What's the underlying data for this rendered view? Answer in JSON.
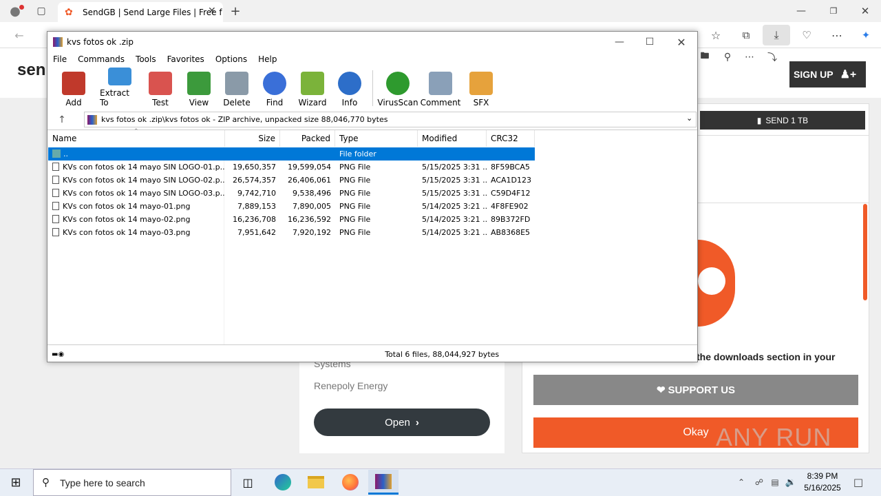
{
  "browser": {
    "tab_title": "SendGB | Send Large Files | Free f",
    "signup_label": "SIGN UP",
    "logo_fragment": "sen"
  },
  "site": {
    "send_button": "SEND 1 TB",
    "downloads_text": "the downloads section in your",
    "support_button": "SUPPORT US",
    "okay_button": "Okay",
    "systems_text": "Systems",
    "renepoly_text": "Renepoly Energy",
    "open_button": "Open",
    "watermark": "ANY RUN"
  },
  "winrar": {
    "title": "kvs fotos ok .zip",
    "menu": [
      "File",
      "Commands",
      "Tools",
      "Favorites",
      "Options",
      "Help"
    ],
    "toolbar": [
      {
        "label": "Add",
        "icon": "add-archive-icon",
        "color": "#c0392b"
      },
      {
        "label": "Extract To",
        "icon": "folder-icon",
        "color": "#3a8fd8"
      },
      {
        "label": "Test",
        "icon": "checklist-icon",
        "color": "#d9534f"
      },
      {
        "label": "View",
        "icon": "book-icon",
        "color": "#3c9a3c"
      },
      {
        "label": "Delete",
        "icon": "trash-icon",
        "color": "#8a9aa8"
      },
      {
        "label": "Find",
        "icon": "magnifier-icon",
        "color": "#3a6fd8"
      },
      {
        "label": "Wizard",
        "icon": "magic-wand-icon",
        "color": "#7bb33a"
      },
      {
        "label": "Info",
        "icon": "info-icon",
        "color": "#2d6ec9"
      },
      {
        "label": "VirusScan",
        "icon": "bug-icon",
        "color": "#2e9a2e"
      },
      {
        "label": "Comment",
        "icon": "comment-icon",
        "color": "#8aa0b8"
      },
      {
        "label": "SFX",
        "icon": "sfx-box-icon",
        "color": "#e6a23c"
      }
    ],
    "path": "kvs fotos ok .zip\\kvs fotos ok  - ZIP archive, unpacked size 88,046,770 bytes",
    "columns": [
      "Name",
      "Size",
      "Packed",
      "Type",
      "Modified",
      "CRC32"
    ],
    "parent_row": {
      "name": "..",
      "type": "File folder"
    },
    "files": [
      {
        "name": "KVs con fotos ok 14 mayo SIN LOGO-01.p...",
        "size": "19,650,357",
        "packed": "19,599,054",
        "type": "PNG File",
        "modified": "5/15/2025 3:31 ...",
        "crc": "8F59BCA5"
      },
      {
        "name": "KVs con fotos ok 14 mayo SIN LOGO-02.p...",
        "size": "26,574,357",
        "packed": "26,406,061",
        "type": "PNG File",
        "modified": "5/15/2025 3:31 ...",
        "crc": "ACA1D123"
      },
      {
        "name": "KVs con fotos ok 14 mayo SIN LOGO-03.p...",
        "size": "9,742,710",
        "packed": "9,538,496",
        "type": "PNG File",
        "modified": "5/15/2025 3:31 ...",
        "crc": "C59D4F12"
      },
      {
        "name": "KVs con fotos ok 14 mayo-01.png",
        "size": "7,889,153",
        "packed": "7,890,005",
        "type": "PNG File",
        "modified": "5/14/2025 3:21 ...",
        "crc": "4F8FE902"
      },
      {
        "name": "KVs con fotos ok 14 mayo-02.png",
        "size": "16,236,708",
        "packed": "16,236,592",
        "type": "PNG File",
        "modified": "5/14/2025 3:21 ...",
        "crc": "89B372FD"
      },
      {
        "name": "KVs con fotos ok 14 mayo-03.png",
        "size": "7,951,642",
        "packed": "7,920,192",
        "type": "PNG File",
        "modified": "5/14/2025 3:21 ...",
        "crc": "AB8368E5"
      }
    ],
    "status": "Total 6 files, 88,044,927 bytes"
  },
  "taskbar": {
    "search_placeholder": "Type here to search",
    "time": "8:39 PM",
    "date": "5/16/2025"
  },
  "colors": {
    "accent": "#f05a28",
    "selection": "#0078d7",
    "dark": "#333333"
  }
}
